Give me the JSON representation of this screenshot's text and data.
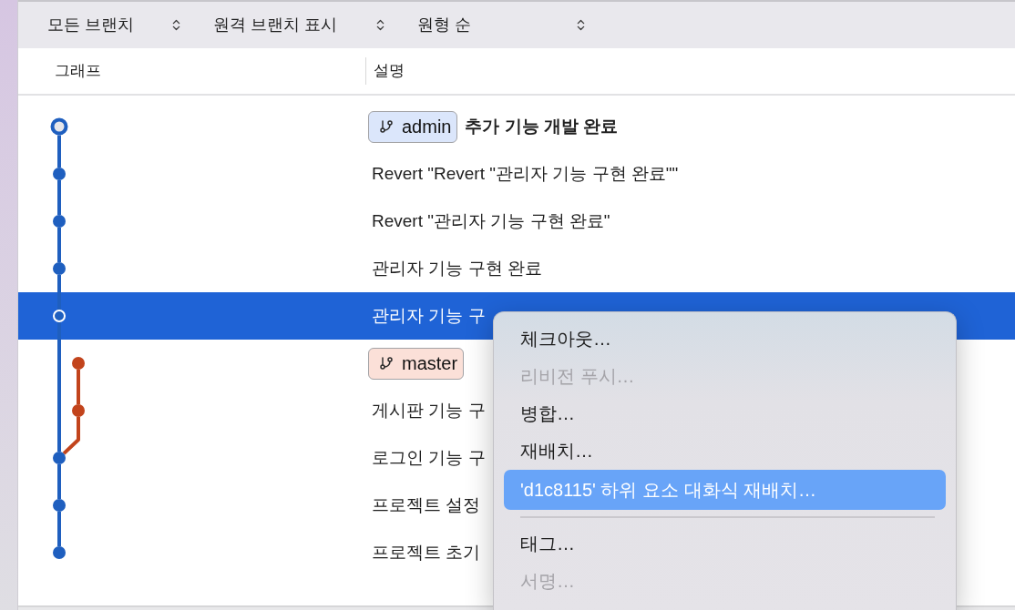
{
  "toolbar": {
    "popups": [
      {
        "label": "모든 브랜치"
      },
      {
        "label": "원격 브랜치 표시"
      },
      {
        "label": "원형 순"
      }
    ]
  },
  "columns": [
    {
      "label": "그래프"
    },
    {
      "label": "설명"
    }
  ],
  "commits": [
    {
      "kind": "main",
      "color": "#1f5fbf",
      "head": true,
      "selected": false,
      "refs": [
        {
          "name": "admin",
          "color": "#dbe6fb"
        }
      ],
      "message": "추가 기능 개발 완료"
    },
    {
      "kind": "main",
      "color": "#1f5fbf",
      "head": false,
      "selected": false,
      "message": "Revert \"Revert \"관리자 기능 구현 완료\"\""
    },
    {
      "kind": "main",
      "color": "#1f5fbf",
      "head": false,
      "selected": false,
      "message": "Revert \"관리자 기능 구현 완료\""
    },
    {
      "kind": "main",
      "color": "#1f5fbf",
      "head": false,
      "selected": false,
      "message": "관리자 기능 구현 완료"
    },
    {
      "kind": "main",
      "color": "#1f5fbf",
      "head": false,
      "selected": true,
      "message": "관리자 기능 구"
    },
    {
      "kind": "side",
      "color": "#c2441c",
      "head": false,
      "selected": false,
      "refs": [
        {
          "name": "master",
          "color": "#fbe0d8"
        }
      ]
    },
    {
      "kind": "side",
      "color": "#c2441c",
      "head": false,
      "selected": false,
      "message": "게시판 기능 구"
    },
    {
      "kind": "main",
      "color": "#1f5fbf",
      "head": false,
      "selected": false,
      "message": "로그인 기능 구"
    },
    {
      "kind": "main",
      "color": "#1f5fbf",
      "head": false,
      "selected": false,
      "message": "프로젝트 설정"
    },
    {
      "kind": "main",
      "color": "#1f5fbf",
      "head": false,
      "selected": false,
      "message": "프로젝트 초기"
    }
  ],
  "context_menu": {
    "items": [
      {
        "kind": "item",
        "label": "체크아웃…",
        "disabled": false,
        "selected": false
      },
      {
        "kind": "item",
        "label": "리비전 푸시…",
        "disabled": true,
        "selected": false
      },
      {
        "kind": "item",
        "label": "병합…",
        "disabled": false,
        "selected": false
      },
      {
        "kind": "item",
        "label": "재배치…",
        "disabled": false,
        "selected": false
      },
      {
        "kind": "item",
        "label": "'d1c8115' 하위 요소 대화식 재배치…",
        "disabled": false,
        "selected": true
      },
      {
        "kind": "separator"
      },
      {
        "kind": "item",
        "label": "태그…",
        "disabled": false,
        "selected": false
      },
      {
        "kind": "item",
        "label": "서명…",
        "disabled": true,
        "selected": false
      }
    ]
  }
}
